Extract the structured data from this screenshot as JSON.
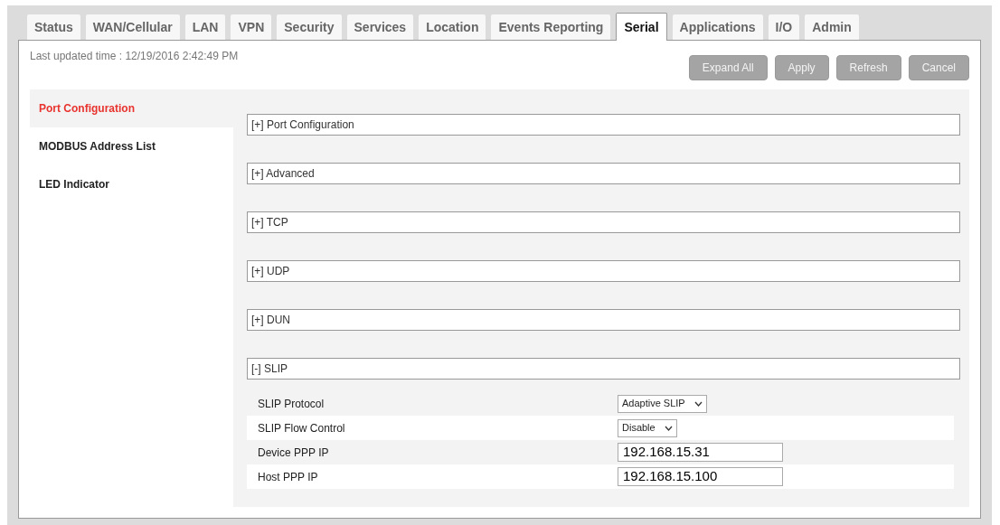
{
  "tabs": [
    {
      "label": "Status",
      "selected": false
    },
    {
      "label": "WAN/Cellular",
      "selected": false
    },
    {
      "label": "LAN",
      "selected": false
    },
    {
      "label": "VPN",
      "selected": false
    },
    {
      "label": "Security",
      "selected": false
    },
    {
      "label": "Services",
      "selected": false
    },
    {
      "label": "Location",
      "selected": false
    },
    {
      "label": "Events Reporting",
      "selected": false
    },
    {
      "label": "Serial",
      "selected": true
    },
    {
      "label": "Applications",
      "selected": false
    },
    {
      "label": "I/O",
      "selected": false
    },
    {
      "label": "Admin",
      "selected": false
    }
  ],
  "last_updated": "Last updated time : 12/19/2016 2:42:49 PM",
  "buttons": [
    "Expand All",
    "Apply",
    "Refresh",
    "Cancel"
  ],
  "sidebar": {
    "items": [
      {
        "label": "Port Configuration",
        "selected": true
      },
      {
        "label": "MODBUS Address List",
        "selected": false
      },
      {
        "label": "LED Indicator",
        "selected": false
      }
    ]
  },
  "sections": [
    {
      "title": "[+] Port Configuration"
    },
    {
      "title": "[+] Advanced"
    },
    {
      "title": "[+] TCP"
    },
    {
      "title": "[+] UDP"
    },
    {
      "title": "[+] DUN"
    },
    {
      "title": "[-] SLIP",
      "fields": [
        {
          "label": "SLIP Protocol",
          "kind": "select",
          "value": "Adaptive SLIP"
        },
        {
          "label": "SLIP Flow Control",
          "kind": "select",
          "value": "Disable"
        },
        {
          "label": "Device PPP IP",
          "kind": "input",
          "value": "192.168.15.31"
        },
        {
          "label": "Host PPP IP",
          "kind": "input",
          "value": "192.168.15.100"
        }
      ]
    }
  ]
}
